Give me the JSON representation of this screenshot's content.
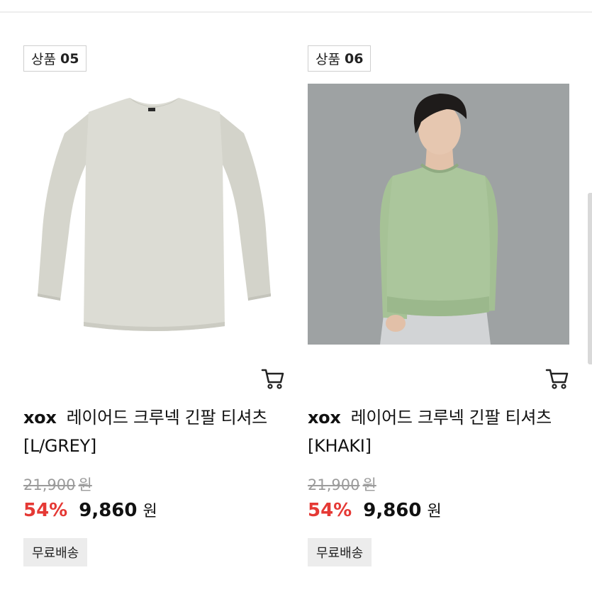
{
  "products": [
    {
      "badge_prefix": "상품",
      "badge_number": "05",
      "image_icon": "grey-long-sleeve-tshirt-image",
      "brand": "xox",
      "name": "레이어드 크루넥 긴팔 티셔츠 [L/GREY]",
      "original_price": "21,900",
      "original_currency": "원",
      "discount": "54%",
      "sale_price": "9,860",
      "sale_currency": "원",
      "shipping": "무료배송",
      "color": "#d9d9d2"
    },
    {
      "badge_prefix": "상품",
      "badge_number": "06",
      "image_icon": "khaki-tshirt-model-image",
      "brand": "xox",
      "name": "레이어드 크루넥 긴팔 티셔츠 [KHAKI]",
      "original_price": "21,900",
      "original_currency": "원",
      "discount": "54%",
      "sale_price": "9,860",
      "sale_currency": "원",
      "shipping": "무료배송",
      "color": "#a9c49a"
    }
  ],
  "icons": {
    "cart": "cart-icon"
  },
  "colors": {
    "discount": "#e53935",
    "shipping_bg": "#ececec"
  }
}
